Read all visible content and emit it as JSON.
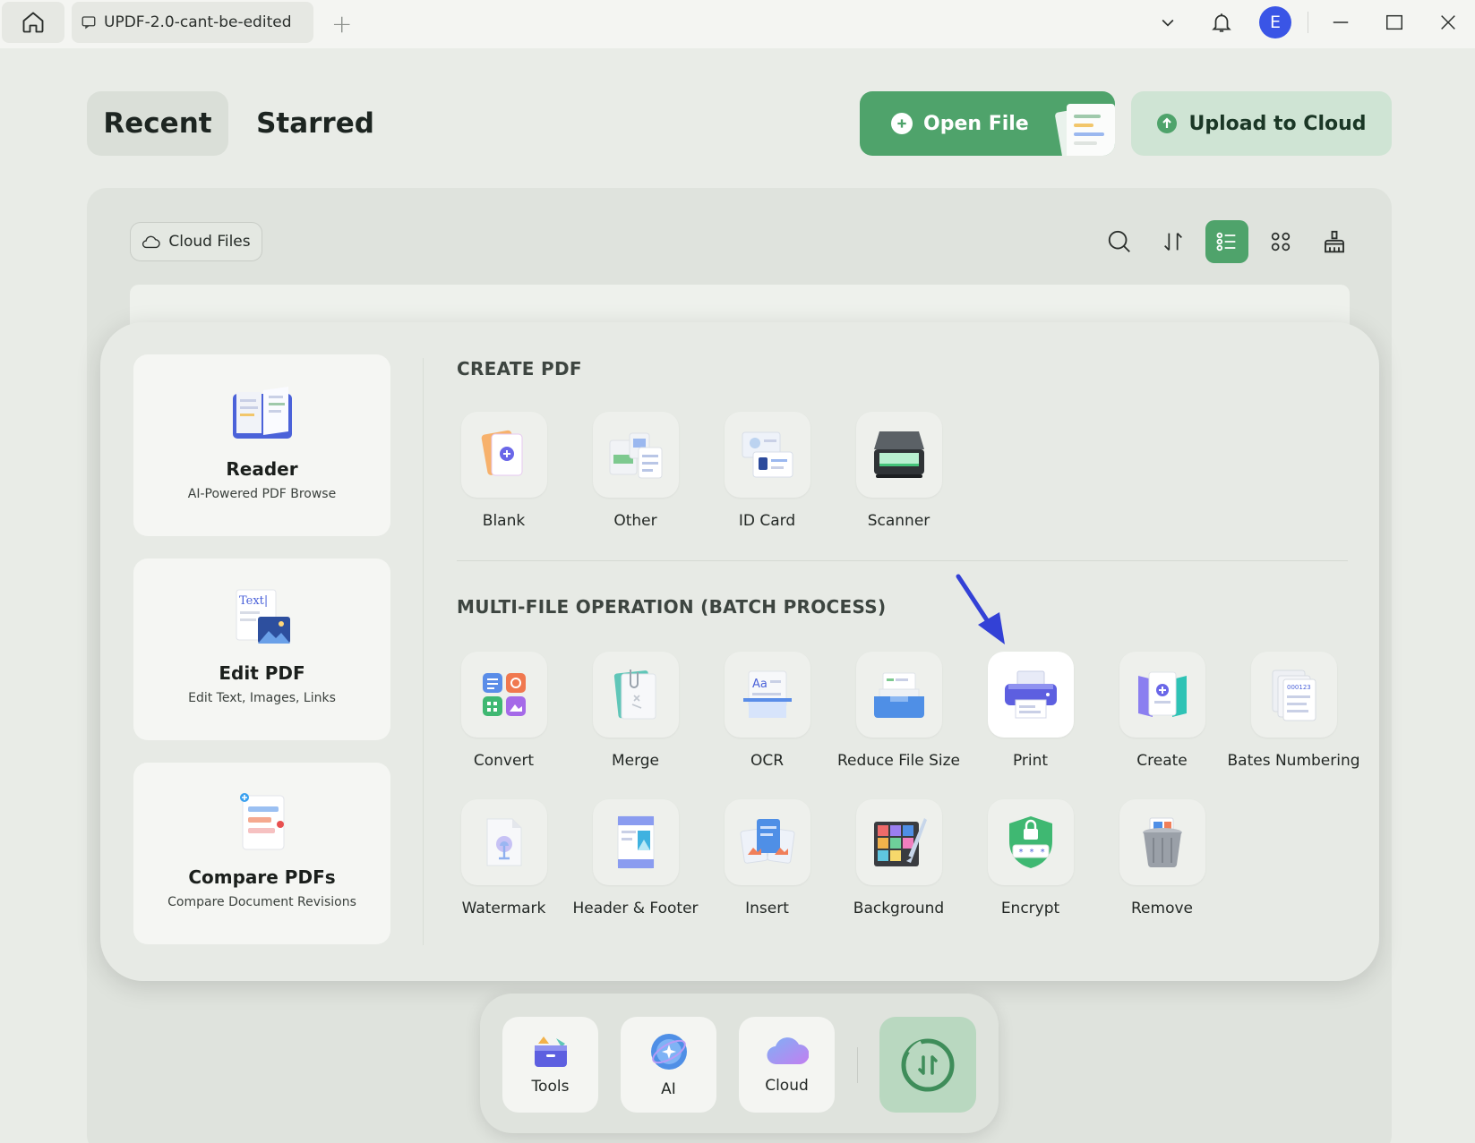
{
  "titlebar": {
    "tab_title": "UPDF-2.0-cant-be-edited",
    "avatar_letter": "E"
  },
  "tabs": {
    "recent": "Recent",
    "starred": "Starred"
  },
  "actions": {
    "open_file": "Open File",
    "upload_to_cloud": "Upload to Cloud"
  },
  "toolbar": {
    "cloud_files": "Cloud Files"
  },
  "features": [
    {
      "title": "Reader",
      "subtitle": "AI-Powered PDF Browse"
    },
    {
      "title": "Edit PDF",
      "subtitle": "Edit Text, Images, Links"
    },
    {
      "title": "Compare PDFs",
      "subtitle": "Compare Document Revisions"
    }
  ],
  "create_pdf": {
    "title": "CREATE PDF",
    "items": [
      "Blank",
      "Other",
      "ID Card",
      "Scanner"
    ]
  },
  "batch": {
    "title": "MULTI-FILE OPERATION (BATCH PROCESS)",
    "items": [
      "Convert",
      "Merge",
      "OCR",
      "Reduce File Size",
      "Print",
      "Create",
      "Bates Numbering",
      "Watermark",
      "Header & Footer",
      "Insert",
      "Background",
      "Encrypt",
      "Remove"
    ]
  },
  "dock": {
    "tools": "Tools",
    "ai": "AI",
    "cloud": "Cloud"
  },
  "colors": {
    "accent": "#4fa36b",
    "accent_light": "#cfe4d4",
    "annotation_arrow": "#3341d6"
  }
}
